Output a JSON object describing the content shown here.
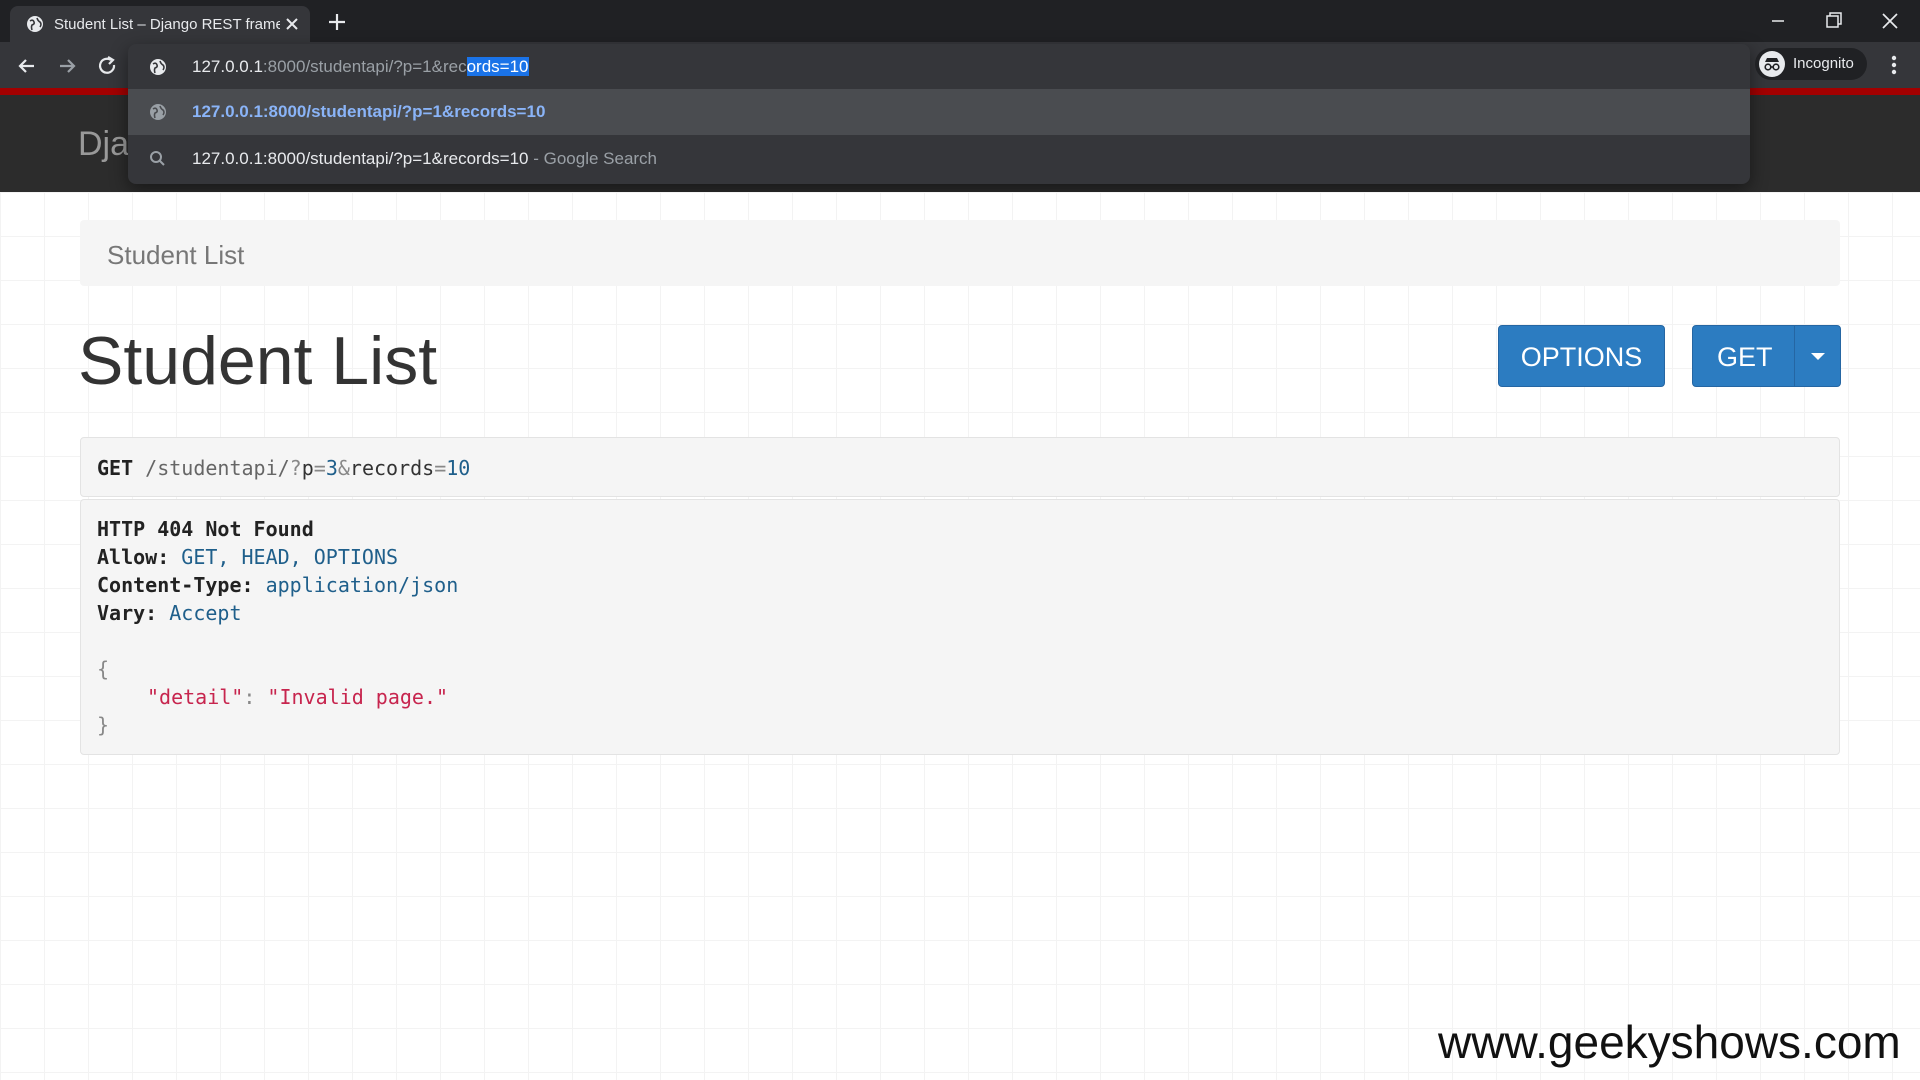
{
  "browser": {
    "tab_title": "Student List – Django REST frame",
    "url_host": "127.0.0.1",
    "url_rest": ":8000/studentapi/?p=1&rec",
    "url_selected": "ords=10",
    "suggestion_url": "127.0.0.1:8000/studentapi/?p=1&records=10",
    "suggestion_search_query": "127.0.0.1:8000/studentapi/?p=1&records=10",
    "suggestion_search_suffix": " - Google Search",
    "incognito_label": "Incognito",
    "colors": {
      "tabstrip": "#202124",
      "toolbar": "#35363a",
      "accent": "#1a73e8"
    }
  },
  "navbar": {
    "brand": "Dja",
    "accent_color": "#a30000"
  },
  "breadcrumb": {
    "label": "Student List"
  },
  "page": {
    "title": "Student List",
    "options_button": "OPTIONS",
    "get_button": "GET",
    "button_color": "#2c7cc1"
  },
  "request": {
    "method": "GET",
    "path": " /studentapi/",
    "q_mark": "?",
    "p_key": "p",
    "eq1": "=",
    "p_val": "3",
    "amp": "&",
    "records_key": "records",
    "eq2": "=",
    "records_val": "10"
  },
  "response": {
    "status_line": "HTTP 404 Not Found",
    "allow_label": "Allow:",
    "allow_value": "GET, HEAD, OPTIONS",
    "content_type_label": "Content-Type:",
    "content_type_value": "application/json",
    "vary_label": "Vary:",
    "vary_value": "Accept",
    "open_brace": "{",
    "detail_key": "\"detail\"",
    "colon": ": ",
    "detail_value": "\"Invalid page.\"",
    "close_brace": "}"
  },
  "watermark": "www.geekyshows.com",
  "icons": {
    "favicon": "globe-icon",
    "tab_close": "close-icon",
    "new_tab": "plus-icon",
    "back": "arrow-left-icon",
    "forward": "arrow-right-icon",
    "reload": "reload-icon",
    "suggestion_search": "search-icon",
    "incognito": "incognito-icon",
    "menu": "kebab-menu-icon"
  }
}
